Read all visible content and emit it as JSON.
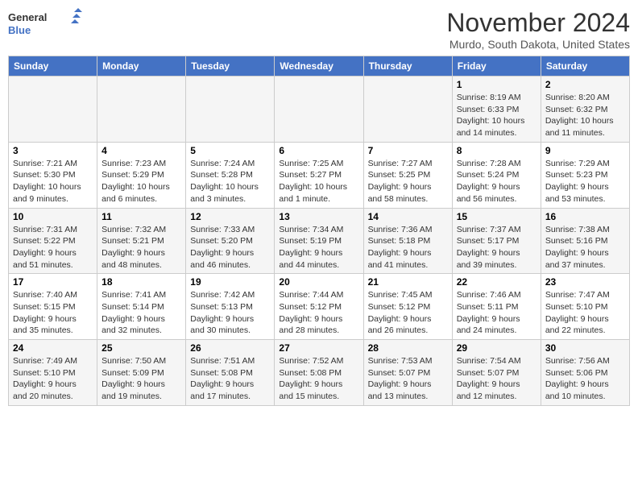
{
  "header": {
    "logo_general": "General",
    "logo_blue": "Blue",
    "month": "November 2024",
    "location": "Murdo, South Dakota, United States"
  },
  "days_of_week": [
    "Sunday",
    "Monday",
    "Tuesday",
    "Wednesday",
    "Thursday",
    "Friday",
    "Saturday"
  ],
  "weeks": [
    [
      {
        "day": "",
        "info": ""
      },
      {
        "day": "",
        "info": ""
      },
      {
        "day": "",
        "info": ""
      },
      {
        "day": "",
        "info": ""
      },
      {
        "day": "",
        "info": ""
      },
      {
        "day": "1",
        "info": "Sunrise: 8:19 AM\nSunset: 6:33 PM\nDaylight: 10 hours and 14 minutes."
      },
      {
        "day": "2",
        "info": "Sunrise: 8:20 AM\nSunset: 6:32 PM\nDaylight: 10 hours and 11 minutes."
      }
    ],
    [
      {
        "day": "3",
        "info": "Sunrise: 7:21 AM\nSunset: 5:30 PM\nDaylight: 10 hours and 9 minutes."
      },
      {
        "day": "4",
        "info": "Sunrise: 7:23 AM\nSunset: 5:29 PM\nDaylight: 10 hours and 6 minutes."
      },
      {
        "day": "5",
        "info": "Sunrise: 7:24 AM\nSunset: 5:28 PM\nDaylight: 10 hours and 3 minutes."
      },
      {
        "day": "6",
        "info": "Sunrise: 7:25 AM\nSunset: 5:27 PM\nDaylight: 10 hours and 1 minute."
      },
      {
        "day": "7",
        "info": "Sunrise: 7:27 AM\nSunset: 5:25 PM\nDaylight: 9 hours and 58 minutes."
      },
      {
        "day": "8",
        "info": "Sunrise: 7:28 AM\nSunset: 5:24 PM\nDaylight: 9 hours and 56 minutes."
      },
      {
        "day": "9",
        "info": "Sunrise: 7:29 AM\nSunset: 5:23 PM\nDaylight: 9 hours and 53 minutes."
      }
    ],
    [
      {
        "day": "10",
        "info": "Sunrise: 7:31 AM\nSunset: 5:22 PM\nDaylight: 9 hours and 51 minutes."
      },
      {
        "day": "11",
        "info": "Sunrise: 7:32 AM\nSunset: 5:21 PM\nDaylight: 9 hours and 48 minutes."
      },
      {
        "day": "12",
        "info": "Sunrise: 7:33 AM\nSunset: 5:20 PM\nDaylight: 9 hours and 46 minutes."
      },
      {
        "day": "13",
        "info": "Sunrise: 7:34 AM\nSunset: 5:19 PM\nDaylight: 9 hours and 44 minutes."
      },
      {
        "day": "14",
        "info": "Sunrise: 7:36 AM\nSunset: 5:18 PM\nDaylight: 9 hours and 41 minutes."
      },
      {
        "day": "15",
        "info": "Sunrise: 7:37 AM\nSunset: 5:17 PM\nDaylight: 9 hours and 39 minutes."
      },
      {
        "day": "16",
        "info": "Sunrise: 7:38 AM\nSunset: 5:16 PM\nDaylight: 9 hours and 37 minutes."
      }
    ],
    [
      {
        "day": "17",
        "info": "Sunrise: 7:40 AM\nSunset: 5:15 PM\nDaylight: 9 hours and 35 minutes."
      },
      {
        "day": "18",
        "info": "Sunrise: 7:41 AM\nSunset: 5:14 PM\nDaylight: 9 hours and 32 minutes."
      },
      {
        "day": "19",
        "info": "Sunrise: 7:42 AM\nSunset: 5:13 PM\nDaylight: 9 hours and 30 minutes."
      },
      {
        "day": "20",
        "info": "Sunrise: 7:44 AM\nSunset: 5:12 PM\nDaylight: 9 hours and 28 minutes."
      },
      {
        "day": "21",
        "info": "Sunrise: 7:45 AM\nSunset: 5:12 PM\nDaylight: 9 hours and 26 minutes."
      },
      {
        "day": "22",
        "info": "Sunrise: 7:46 AM\nSunset: 5:11 PM\nDaylight: 9 hours and 24 minutes."
      },
      {
        "day": "23",
        "info": "Sunrise: 7:47 AM\nSunset: 5:10 PM\nDaylight: 9 hours and 22 minutes."
      }
    ],
    [
      {
        "day": "24",
        "info": "Sunrise: 7:49 AM\nSunset: 5:10 PM\nDaylight: 9 hours and 20 minutes."
      },
      {
        "day": "25",
        "info": "Sunrise: 7:50 AM\nSunset: 5:09 PM\nDaylight: 9 hours and 19 minutes."
      },
      {
        "day": "26",
        "info": "Sunrise: 7:51 AM\nSunset: 5:08 PM\nDaylight: 9 hours and 17 minutes."
      },
      {
        "day": "27",
        "info": "Sunrise: 7:52 AM\nSunset: 5:08 PM\nDaylight: 9 hours and 15 minutes."
      },
      {
        "day": "28",
        "info": "Sunrise: 7:53 AM\nSunset: 5:07 PM\nDaylight: 9 hours and 13 minutes."
      },
      {
        "day": "29",
        "info": "Sunrise: 7:54 AM\nSunset: 5:07 PM\nDaylight: 9 hours and 12 minutes."
      },
      {
        "day": "30",
        "info": "Sunrise: 7:56 AM\nSunset: 5:06 PM\nDaylight: 9 hours and 10 minutes."
      }
    ]
  ]
}
